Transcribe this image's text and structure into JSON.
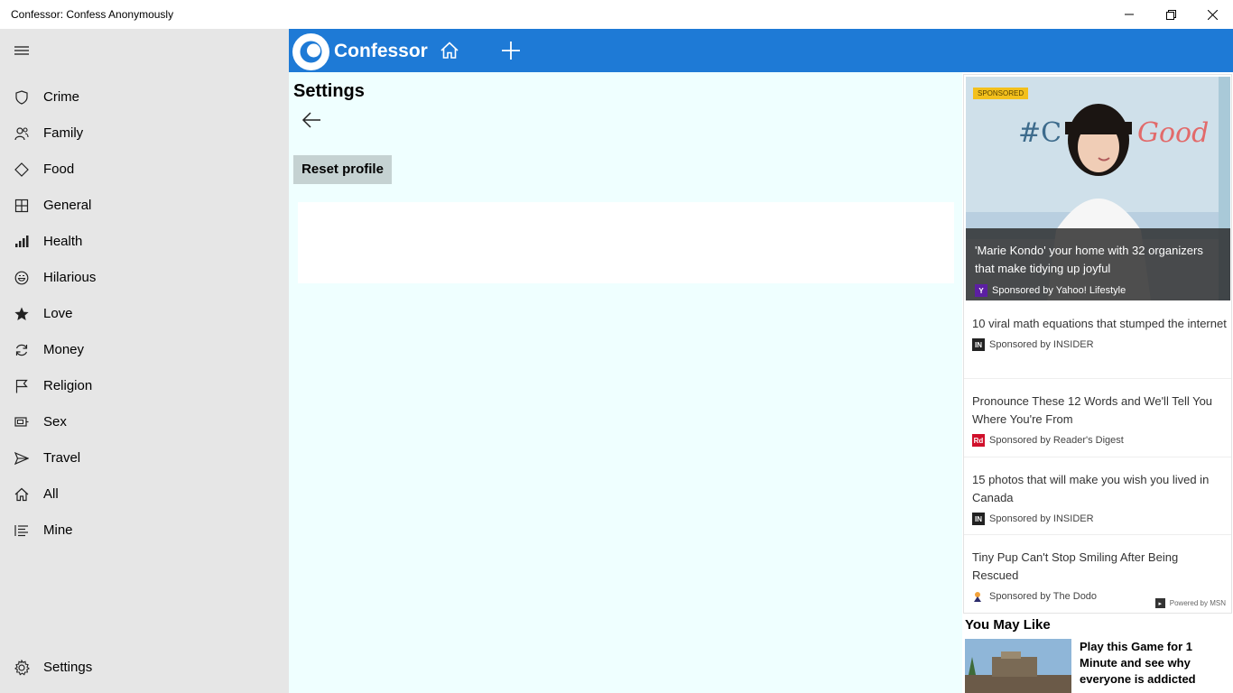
{
  "window": {
    "title": "Confessor: Confess Anonymously"
  },
  "sidebar": {
    "items": [
      {
        "label": "Crime",
        "icon": "shield-icon"
      },
      {
        "label": "Family",
        "icon": "people-icon"
      },
      {
        "label": "Food",
        "icon": "diamond-icon"
      },
      {
        "label": "General",
        "icon": "grid-icon"
      },
      {
        "label": "Health",
        "icon": "signal-bars-icon"
      },
      {
        "label": "Hilarious",
        "icon": "smiley-icon"
      },
      {
        "label": "Love",
        "icon": "star-icon"
      },
      {
        "label": "Money",
        "icon": "refresh-icon"
      },
      {
        "label": "Religion",
        "icon": "flag-icon"
      },
      {
        "label": "Sex",
        "icon": "display-icon"
      },
      {
        "label": "Travel",
        "icon": "send-icon"
      },
      {
        "label": "All",
        "icon": "home-icon"
      },
      {
        "label": "Mine",
        "icon": "list-icon"
      }
    ],
    "settings_label": "Settings"
  },
  "header": {
    "brand": "Confessor"
  },
  "main": {
    "title": "Settings",
    "reset_label": "Reset profile"
  },
  "ads": {
    "badge": "SPONSORED",
    "hero": {
      "title": "'Marie Kondo' your home with 32 organizers that make tidying up joyful",
      "sponsor": "Sponsored by Yahoo! Lifestyle"
    },
    "items": [
      {
        "title": "10 viral math equations that stumped the internet",
        "sponsor": "Sponsored by INSIDER"
      },
      {
        "title": "Pronounce These 12 Words and We'll Tell You Where You're From",
        "sponsor": "Sponsored by Reader's Digest"
      },
      {
        "title": "15 photos that will make you wish you lived in Canada",
        "sponsor": "Sponsored by INSIDER"
      },
      {
        "title": "Tiny Pup Can't Stop Smiling After Being Rescued",
        "sponsor": "Sponsored by The Dodo"
      }
    ],
    "powered_by": "Powered by MSN",
    "you_may_like": {
      "heading": "You May Like",
      "title": "Play this Game for 1 Minute and see why everyone is addicted"
    }
  },
  "colors": {
    "header_bg": "#1e7ad6",
    "sidebar_bg": "#e6e6e6",
    "main_bg": "#efffff",
    "button_bg": "#c5d2d2"
  }
}
